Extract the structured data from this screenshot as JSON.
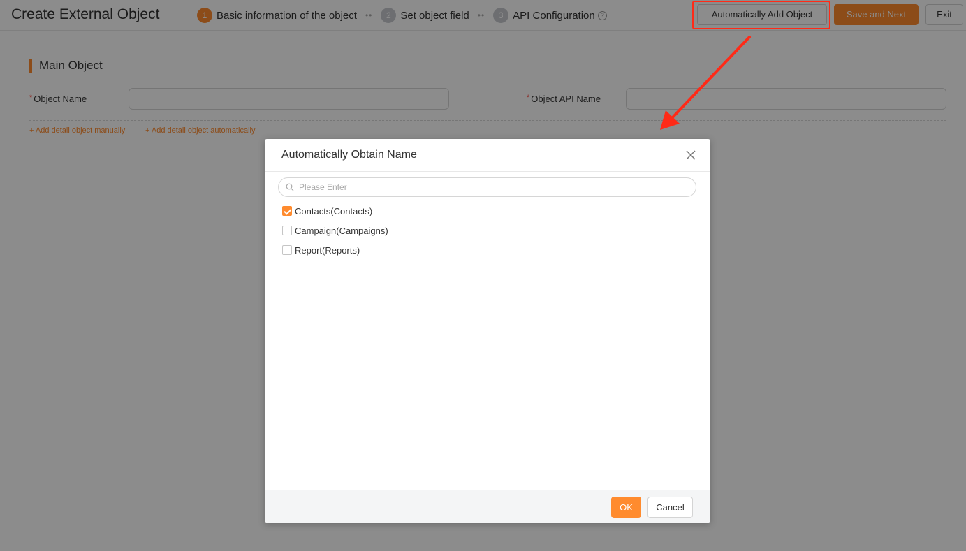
{
  "header": {
    "title": "Create External Object",
    "steps": [
      {
        "num": "1",
        "label": "Basic information of the object"
      },
      {
        "num": "2",
        "label": "Set object field"
      },
      {
        "num": "3",
        "label": "API Configuration"
      }
    ],
    "step_separator": "••",
    "auto_add_label": "Automatically Add Object",
    "save_next_label": "Save and Next",
    "exit_label": "Exit"
  },
  "main": {
    "section_title": "Main Object",
    "required_mark": "*",
    "object_name_label": "Object Name",
    "object_api_name_label": "Object API Name",
    "add_manual_link": "+ Add detail object manually",
    "add_auto_link": "+ Add detail object automatically"
  },
  "dialog": {
    "title": "Automatically Obtain Name",
    "search_placeholder": "Please Enter",
    "options": [
      {
        "label": "Contacts(Contacts)",
        "checked": true
      },
      {
        "label": "Campaign(Campaigns)",
        "checked": false
      },
      {
        "label": "Report(Reports)",
        "checked": false
      }
    ],
    "ok_label": "OK",
    "cancel_label": "Cancel"
  },
  "colors": {
    "accent": "#ff8b2e",
    "annotation": "#ff2a17"
  }
}
